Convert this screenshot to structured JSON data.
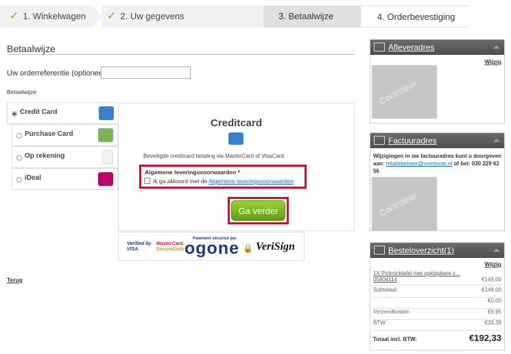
{
  "steps": [
    {
      "num": "1.",
      "label": "Winkelwagen",
      "done": true
    },
    {
      "num": "2.",
      "label": "Uw gegevens",
      "done": true
    },
    {
      "num": "3.",
      "label": "Betaalwijze",
      "done": false
    },
    {
      "num": "4.",
      "label": "Orderbevestiging",
      "done": false
    }
  ],
  "main": {
    "title": "Betaalwijze",
    "orderref_label": "Uw orderreferentie (optioneel)",
    "orderref_value": "",
    "method_label": "Betaalwijze",
    "methods": [
      {
        "label": "Credit Card",
        "selected": true
      },
      {
        "label": "Purchase Card",
        "selected": false
      },
      {
        "label": "Op rekening",
        "selected": false
      },
      {
        "label": "iDeal",
        "selected": false
      }
    ],
    "panel": {
      "title": "Creditcard",
      "description": "Beveiligde creditcard betaling via MasterCard of VisaCard.",
      "terms_heading": "Algemene leveringsvoorwaarden *",
      "terms_text": "Ik ga akkoord met de",
      "terms_link": "Algemene leveringsvoorwaarden",
      "button": "Ga verder"
    },
    "logos": {
      "verified_top": "Verified by",
      "verified_bottom": "VISA",
      "mc_top": "MasterCard.",
      "mc_bottom": "SecureCode",
      "ogone_small": "Paiement sécurisé par",
      "ogone": "ogone",
      "verisign": "VeriSign"
    },
    "back": "Terug"
  },
  "sidebar": {
    "delivery": {
      "title": "Afleveradres",
      "edit": "Wijzig",
      "placeholder": "Controleer"
    },
    "invoice": {
      "title": "Factuuradres",
      "note_pre": "Wijzigingen in uw factuuradres kunt u doorgeven aan:",
      "email": "relatiebeheer@overtoom.nl",
      "note_post": "of bel: 030 229 62 56",
      "placeholder": "Controleer"
    },
    "order": {
      "title": "Besteloverzicht(1)",
      "edit": "Wijzig",
      "item": "1X Picknicktafel met opklapbare z... 05804114",
      "item_price": "€149,00",
      "rows": [
        {
          "label": "Subtotaal:",
          "value": "€149,00"
        },
        {
          "label": "",
          "value": "€0,00"
        },
        {
          "label": "Verzendkosten",
          "value": "€9,95"
        },
        {
          "label": "BTW",
          "value": "€33,38"
        }
      ],
      "total_label": "Totaal incl. BTW:",
      "total_value": "€192,33"
    }
  },
  "colors": {
    "accent_green": "#7ab317",
    "highlight_red": "#c8102e",
    "header_dark": "#555555",
    "link_blue": "#1a6fb5"
  }
}
